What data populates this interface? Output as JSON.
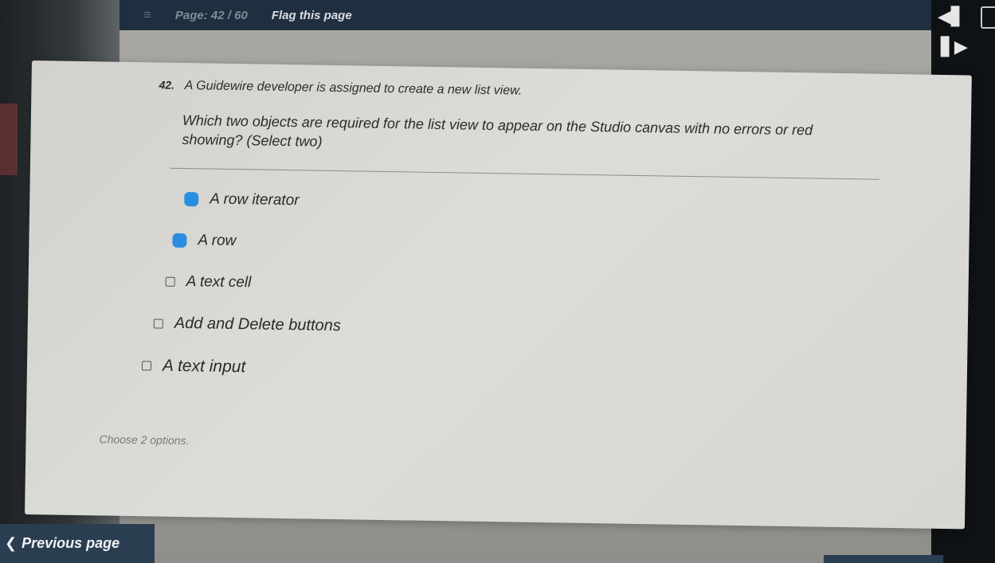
{
  "topbar": {
    "menu_icon": "hamburger-menu-icon",
    "page_indicator": "Page: 42 / 60",
    "flag_label": "Flag this page"
  },
  "right_rail": {
    "collapse_icon": "collapse-left-icon",
    "expand_icon": "expand-right-icon"
  },
  "question": {
    "number": "42.",
    "lead": "A Guidewire developer is assigned to create a new list view.",
    "stem": "Which two objects are required for the list view to appear on the Studio canvas with no errors or red showing? (Select two)"
  },
  "options": [
    {
      "label": "A row iterator",
      "selected": true
    },
    {
      "label": "A row",
      "selected": true
    },
    {
      "label": "A text cell",
      "selected": false
    },
    {
      "label": "Add and Delete buttons",
      "selected": false
    },
    {
      "label": "A text input",
      "selected": false
    }
  ],
  "hint": "Choose 2 options.",
  "nav": {
    "previous_label": "Previous page",
    "previous_icon": "chevron-left-icon"
  },
  "colors": {
    "topbar_bg": "#1f2f3f",
    "selected_checkbox": "#2a8ee0",
    "button_bg": "#2b3d50"
  }
}
